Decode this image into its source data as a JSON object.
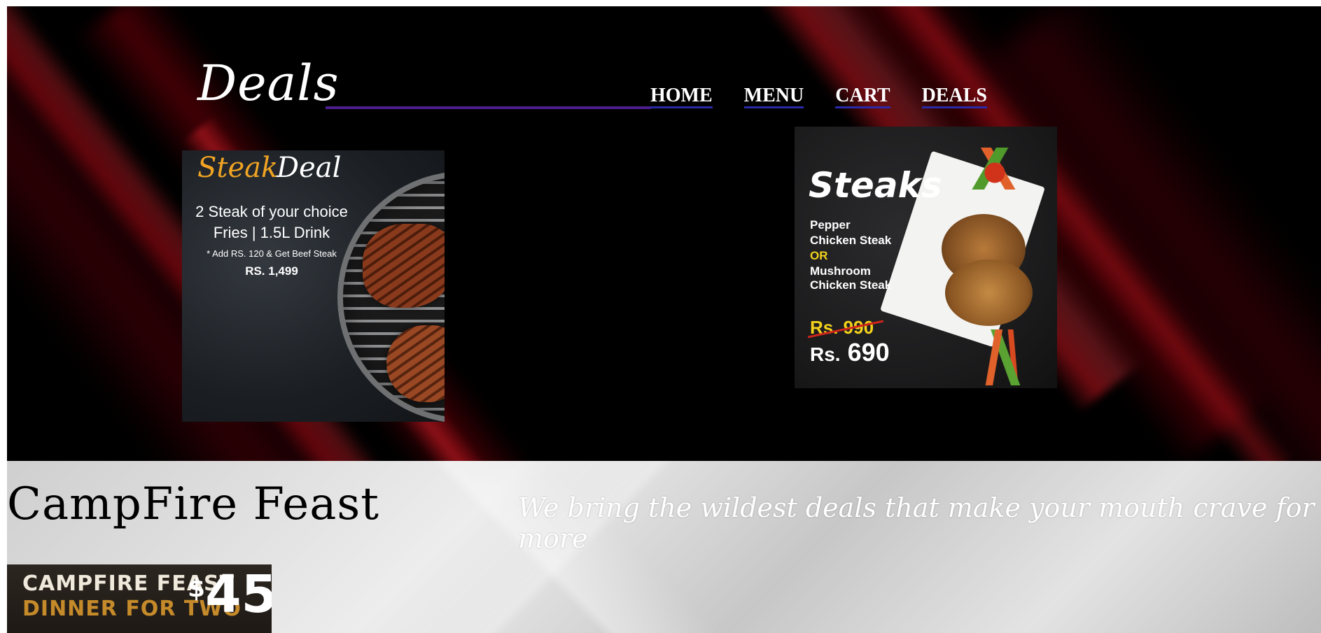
{
  "header": {
    "title": "Deals",
    "nav": [
      {
        "label": "HOME"
      },
      {
        "label": "MENU"
      },
      {
        "label": "CART"
      },
      {
        "label": "DEALS"
      }
    ]
  },
  "deals": {
    "steak_deal": {
      "title_accent": "Steak",
      "title_rest": "Deal",
      "line1": "2 Steak of your choice",
      "line2": "Fries | 1.5L Drink",
      "note": "* Add RS. 120 & Get Beef Steak",
      "price": "RS. 1,499"
    },
    "steaks": {
      "title": "Steaks",
      "item1_a": "Pepper",
      "item1_b": "Chicken Steak",
      "or": "OR",
      "item2_a": "Mushroom",
      "item2_b": "Chicken Steak",
      "old_price": "Rs. 990",
      "new_price_prefix": "Rs.",
      "new_price_value": "690"
    }
  },
  "brand": {
    "name": "CampFire Feast",
    "tagline": "We bring the wildest deals that make your mouth crave for more"
  },
  "campfire_card": {
    "line1": "CAMPFIRE FEAST",
    "line2": "DINNER FOR TWO",
    "currency": "$",
    "price": "45"
  },
  "colors": {
    "hero_background": "#000000",
    "accent_red": "#b00a14",
    "title_underline": "#4b1d8c",
    "nav_underline": "#2a2aa8",
    "steak_accent": "#f0a423",
    "or_yellow": "#f3d21c"
  }
}
